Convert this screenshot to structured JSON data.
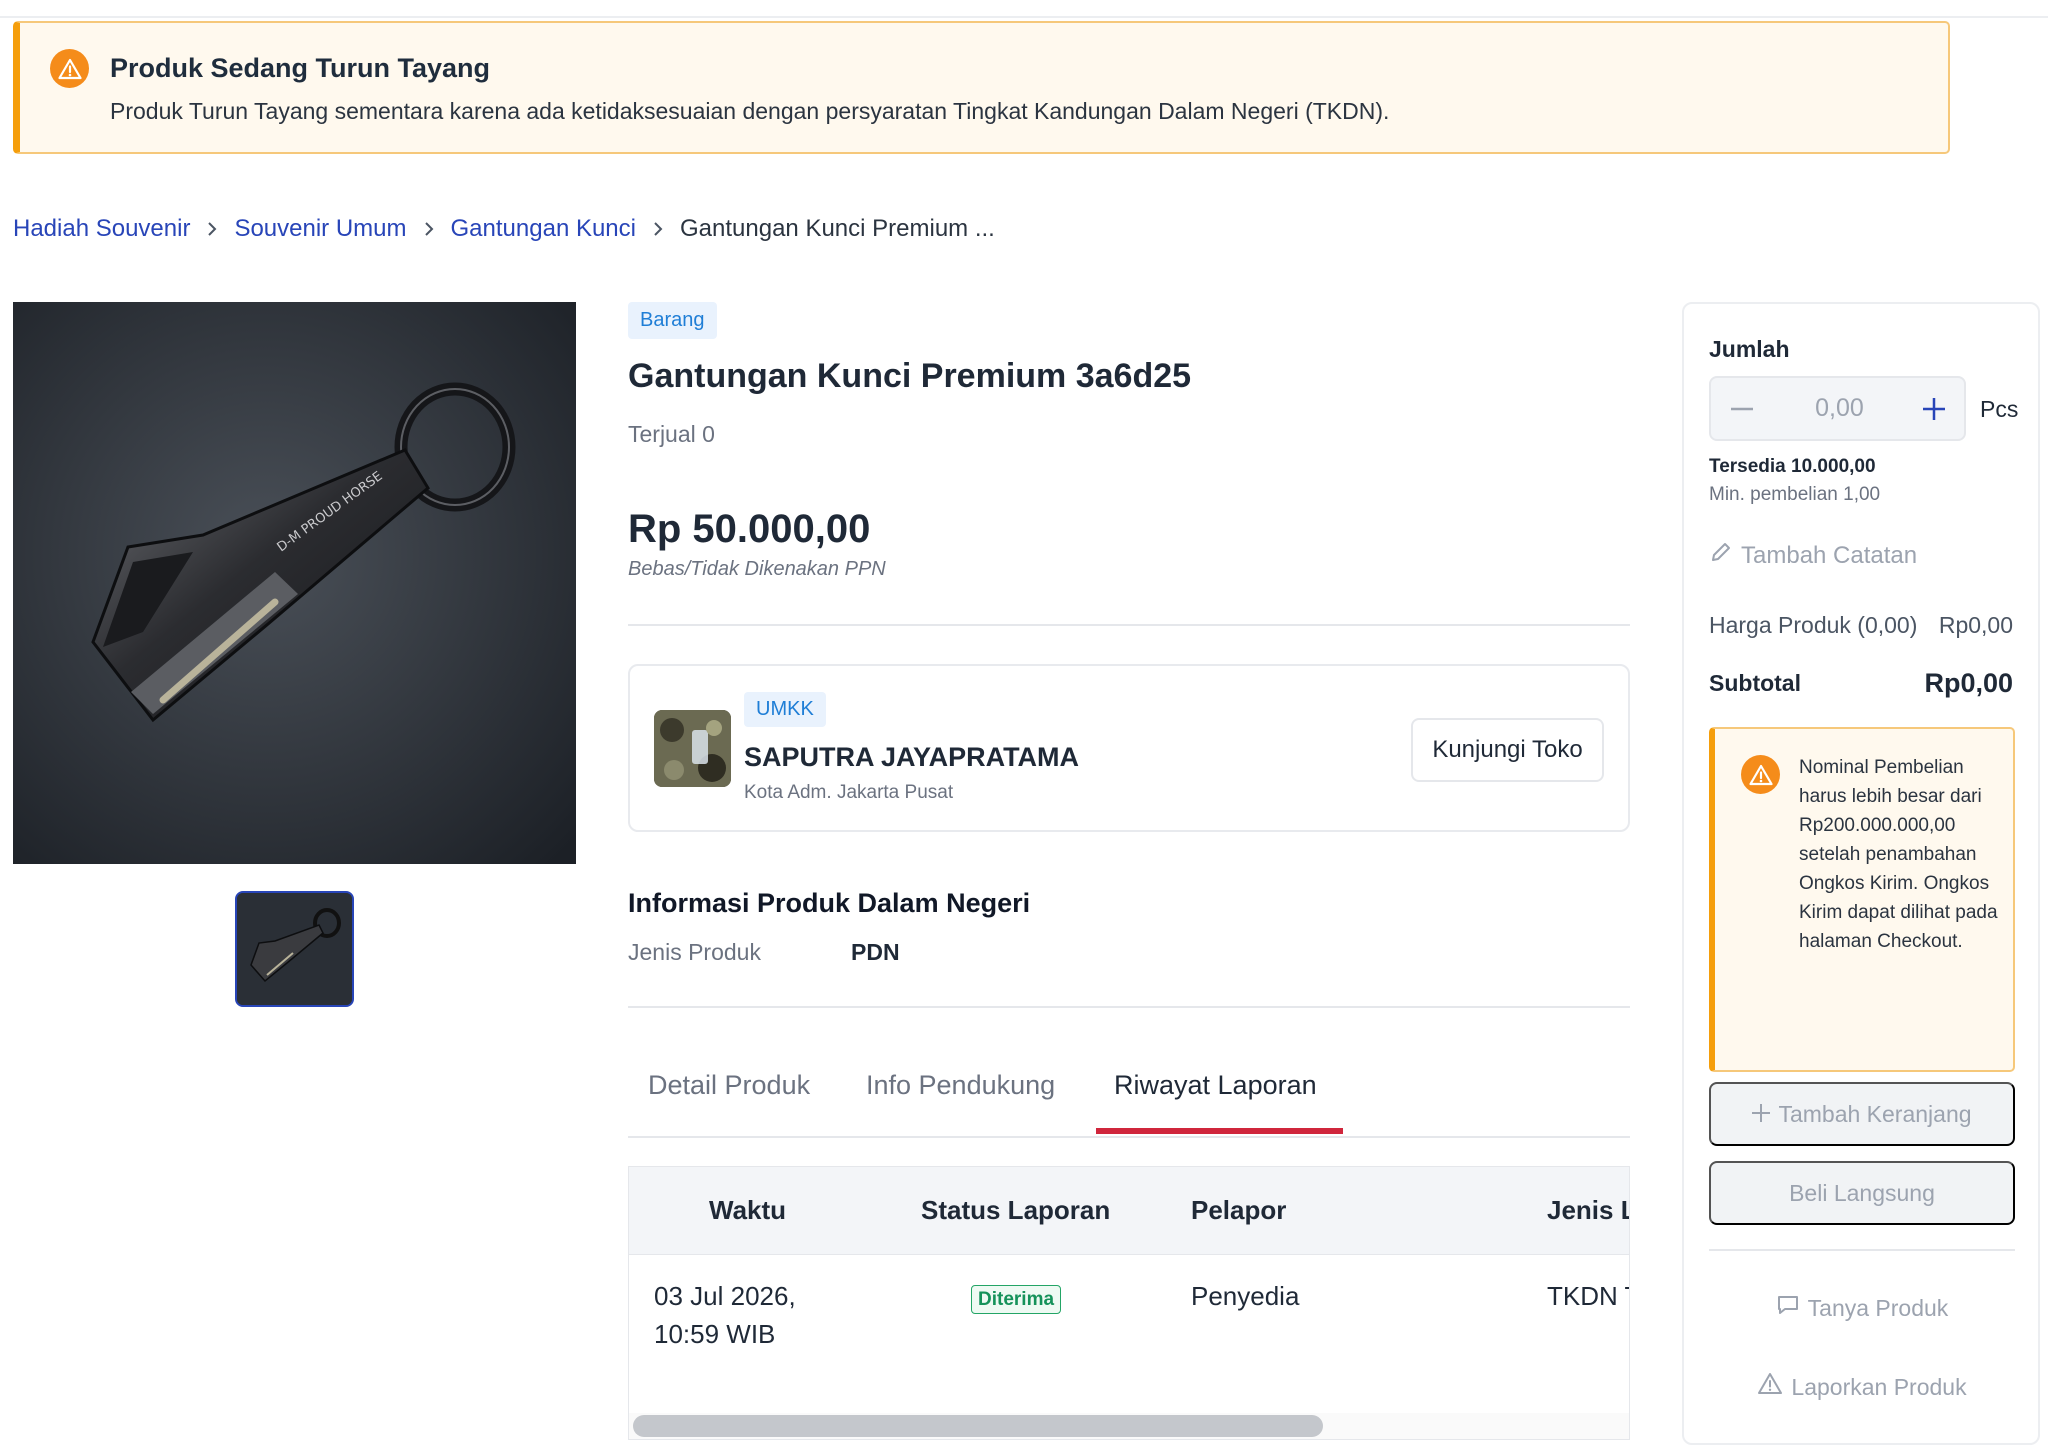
{
  "alert": {
    "title": "Produk Sedang Turun Tayang",
    "message": "Produk Turun Tayang sementara karena ada ketidaksesuaian dengan persyaratan Tingkat Kandungan Dalam Negeri (TKDN)."
  },
  "breadcrumb": [
    {
      "label": "Hadiah Souvenir"
    },
    {
      "label": "Souvenir Umum"
    },
    {
      "label": "Gantungan Kunci"
    },
    {
      "label": "Gantungan Kunci Premium ..."
    }
  ],
  "product": {
    "type_badge": "Barang",
    "title": "Gantungan Kunci Premium 3a6d25",
    "sold": "Terjual 0",
    "price": "Rp 50.000,00",
    "tax_note": "Bebas/Tidak Dikenakan PPN",
    "image_caption": "D-M PROUD HORSE"
  },
  "seller": {
    "badge": "UMKK",
    "name": "SAPUTRA JAYAPRATAMA",
    "location": "Kota Adm. Jakarta Pusat",
    "visit_label": "Kunjungi Toko"
  },
  "pdn": {
    "title": "Informasi Produk Dalam Negeri",
    "label": "Jenis Produk",
    "value": "PDN"
  },
  "tabs": [
    {
      "label": "Detail Produk",
      "active": false
    },
    {
      "label": "Info Pendukung",
      "active": false
    },
    {
      "label": "Riwayat Laporan",
      "active": true
    }
  ],
  "report_table": {
    "headers": [
      "Waktu",
      "Status Laporan",
      "Pelapor",
      "Jenis L"
    ],
    "rows": [
      {
        "waktu_line1": "03 Jul 2026,",
        "waktu_line2": "10:59 WIB",
        "status": "Diterima",
        "pelapor": "Penyedia",
        "jenis": "TKDN T"
      }
    ]
  },
  "purchase": {
    "qty_label": "Jumlah",
    "qty_value": "0,00",
    "unit": "Pcs",
    "stock": "Tersedia 10.000,00",
    "min_buy": "Min. pembelian 1,00",
    "add_note": "Tambah Catatan",
    "price_label": "Harga Produk (0,00)",
    "price_value": "Rp0,00",
    "subtotal_label": "Subtotal",
    "subtotal_value": "Rp0,00",
    "warning": "Nominal Pembelian harus lebih besar dari Rp200.000.000,00 setelah penambahan Ongkos Kirim. Ongkos Kirim dapat dilihat pada halaman Checkout.",
    "add_cart": "Tambah Keranjang",
    "buy_now": "Beli Langsung",
    "ask": "Tanya Produk",
    "report": "Laporkan Produk"
  },
  "colors": {
    "link": "#2845b8",
    "warning": "#f58c1a",
    "accent_red": "#d0263c",
    "success": "#15925a"
  },
  "icons": [
    "warning-icon",
    "chevron-right-icon",
    "pencil-icon",
    "plus-icon",
    "minus-icon",
    "chat-icon",
    "alert-triangle-icon"
  ]
}
